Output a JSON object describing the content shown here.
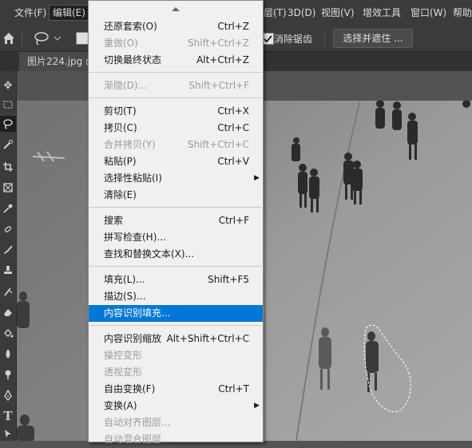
{
  "menubar": {
    "file": "文件(F)",
    "edit": "编辑(E)",
    "layer": "层(T)",
    "threeD": "3D(D)",
    "view": "视图(V)",
    "plugins": "增效工具",
    "window": "窗口(W)",
    "help": "帮助"
  },
  "options": {
    "antialias_label": "消除锯齿",
    "antialias_checked": true,
    "select_mask_label": "选择并遮住 ..."
  },
  "document": {
    "tab_title": "图片224.jpg @"
  },
  "edit_menu": {
    "items": [
      {
        "label": "还原套索(O)",
        "shortcut": "Ctrl+Z",
        "disabled": false
      },
      {
        "label": "重做(O)",
        "shortcut": "Shift+Ctrl+Z",
        "disabled": true
      },
      {
        "label": "切换最终状态",
        "shortcut": "Alt+Ctrl+Z",
        "disabled": false
      },
      {
        "label": "渐隐(D)...",
        "shortcut": "Shift+Ctrl+F",
        "disabled": true
      },
      {
        "label": "剪切(T)",
        "shortcut": "Ctrl+X",
        "disabled": false
      },
      {
        "label": "拷贝(C)",
        "shortcut": "Ctrl+C",
        "disabled": false
      },
      {
        "label": "合并拷贝(Y)",
        "shortcut": "Shift+Ctrl+C",
        "disabled": true
      },
      {
        "label": "粘贴(P)",
        "shortcut": "Ctrl+V",
        "disabled": false
      },
      {
        "label": "选择性粘贴(I)",
        "shortcut": "",
        "disabled": false,
        "submenu": true
      },
      {
        "label": "清除(E)",
        "shortcut": "",
        "disabled": false
      },
      {
        "label": "搜索",
        "shortcut": "Ctrl+F",
        "disabled": false
      },
      {
        "label": "拼写检查(H)...",
        "shortcut": "",
        "disabled": false
      },
      {
        "label": "查找和替换文本(X)...",
        "shortcut": "",
        "disabled": false
      },
      {
        "label": "填充(L)...",
        "shortcut": "Shift+F5",
        "disabled": false
      },
      {
        "label": "描边(S)...",
        "shortcut": "",
        "disabled": false
      },
      {
        "label": "内容识别填充...",
        "shortcut": "",
        "disabled": false,
        "highlighted": true
      },
      {
        "label": "内容识别缩放",
        "shortcut": "Alt+Shift+Ctrl+C",
        "disabled": false
      },
      {
        "label": "操控变形",
        "shortcut": "",
        "disabled": true
      },
      {
        "label": "透视变形",
        "shortcut": "",
        "disabled": true
      },
      {
        "label": "自由变换(F)",
        "shortcut": "Ctrl+T",
        "disabled": false
      },
      {
        "label": "变换(A)",
        "shortcut": "",
        "disabled": false,
        "submenu": true
      },
      {
        "label": "自动对齐图层...",
        "shortcut": "",
        "disabled": true
      },
      {
        "label": "自动混合图层...",
        "shortcut": "",
        "disabled": true
      }
    ]
  },
  "icons": {
    "home": "home-icon",
    "lasso": "lasso-icon",
    "scroll_up": "scroll-up-arrow-icon",
    "submenu": "submenu-arrow-icon"
  },
  "colors": {
    "menu_highlight": "#0078d7",
    "menu_bg": "#f0f0f0",
    "chrome_bg": "#3b3b3b"
  }
}
